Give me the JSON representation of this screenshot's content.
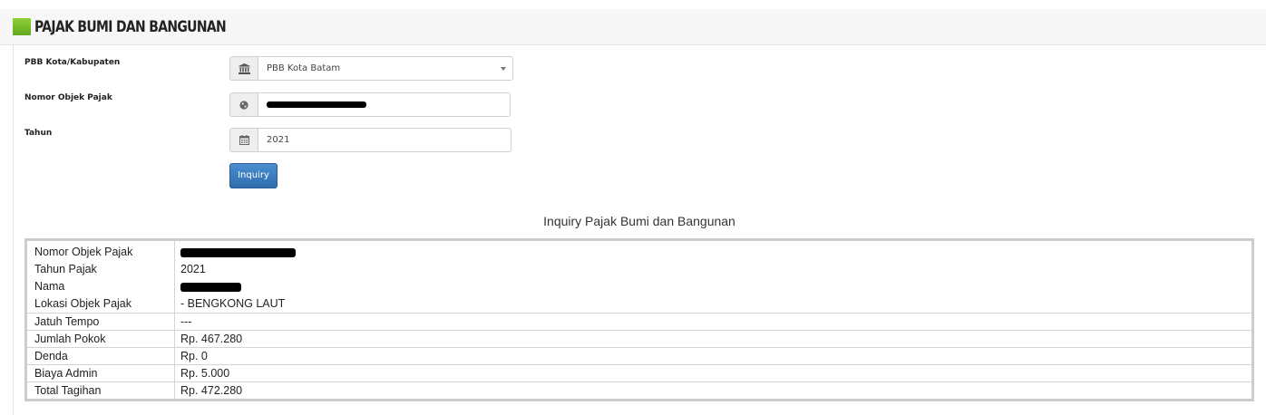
{
  "header": {
    "title": "PAJAK BUMI DAN BANGUNAN",
    "accent_color": "#7bbd2b"
  },
  "form": {
    "kota_label": "PBB Kota/Kabupaten",
    "kota_value": "PBB Kota Batam",
    "kota_icon": "institution-icon",
    "nop_label": "Nomor Objek Pajak",
    "nop_icon": "globe-icon",
    "tahun_label": "Tahun",
    "tahun_value": "2021",
    "tahun_icon": "calendar-icon",
    "inquiry_button": "Inquiry",
    "button_color": "#3a7dc0"
  },
  "result": {
    "title": "Inquiry Pajak Bumi dan Bangunan",
    "rows": [
      {
        "label": "Nomor Objek Pajak",
        "value": ""
      },
      {
        "label": "Tahun Pajak",
        "value": "2021"
      },
      {
        "label": "Nama",
        "value": ""
      },
      {
        "label": "Lokasi Objek Pajak",
        "value": "- BENGKONG LAUT"
      },
      {
        "label": "Jatuh Tempo",
        "value": "---"
      },
      {
        "label": "Jumlah Pokok",
        "value": "Rp. 467.280"
      },
      {
        "label": "Denda",
        "value": "Rp. 0"
      },
      {
        "label": "Biaya Admin",
        "value": "Rp. 5.000"
      },
      {
        "label": "Total Tagihan",
        "value": "Rp. 472.280"
      }
    ]
  }
}
